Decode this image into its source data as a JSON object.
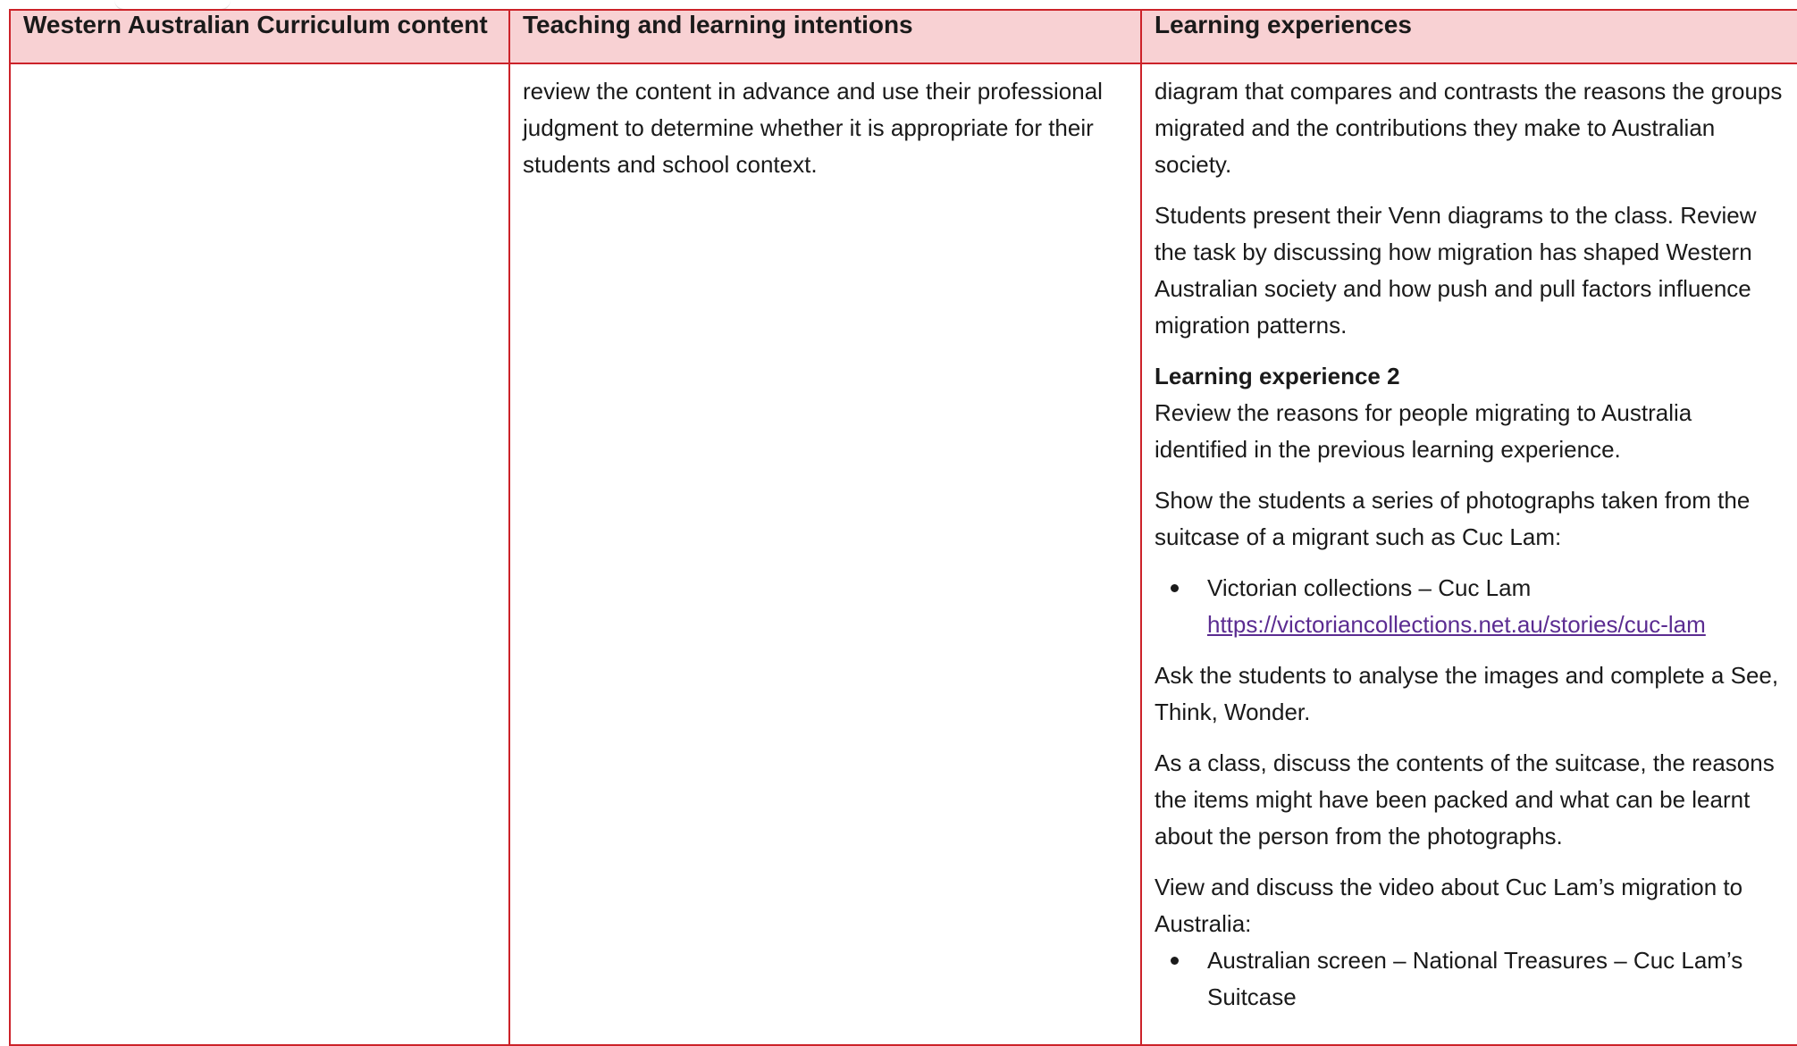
{
  "table": {
    "headers": [
      "Western Australian Curriculum content",
      "Teaching and learning intentions",
      "Learning experiences"
    ],
    "col1": "",
    "col2": [
      "review the content in advance and use their professional judgment to determine whether it is appropriate for their students and school context."
    ],
    "col3": {
      "p1": "diagram that compares and contrasts the reasons the groups migrated and the contributions they make to Australian society.",
      "p2": "Students present their Venn diagrams to the class. Review the task by discussing how migration has shaped Western Australian society and how push and pull factors influence migration patterns.",
      "heading": "Learning experience 2",
      "p3": "Review the reasons for people migrating to Australia identified in the previous learning experience.",
      "p4": "Show the students a series of photographs taken from the suitcase of a migrant such as Cuc Lam:",
      "bullet1": {
        "label": "Victorian collections – Cuc Lam",
        "url": "https://victoriancollections.net.au/stories/cuc-lam"
      },
      "p5": "Ask the students to analyse the images and complete a See, Think, Wonder.",
      "p6": "As a class, discuss the contents of the suitcase, the reasons the items might have been packed and what can be learnt about the person from the photographs.",
      "p7": "View and discuss the video about Cuc Lam’s migration to Australia:",
      "bullet2": "Australian screen – National Treasures – Cuc Lam’s Suitcase"
    }
  },
  "colors": {
    "border": "#cc2229",
    "header_fill": "#f8d1d3",
    "link": "#5b2c91"
  }
}
